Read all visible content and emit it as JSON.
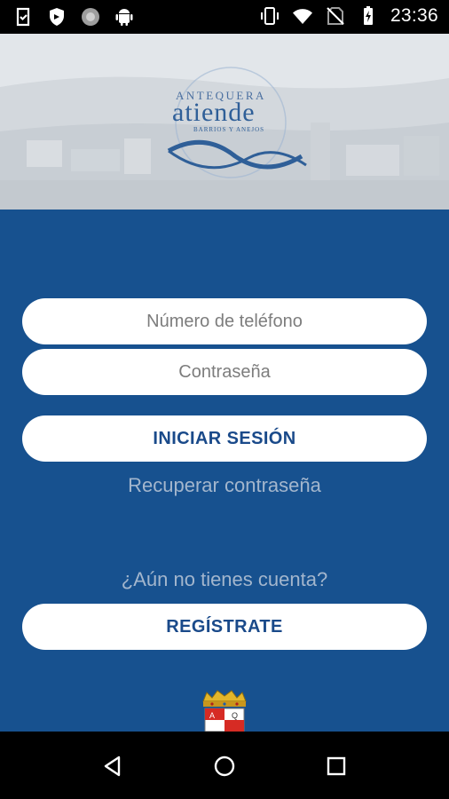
{
  "status_bar": {
    "time": "23:36",
    "left_icons": [
      "clipboard-check-icon",
      "shield-icon",
      "circle-icon",
      "android-icon"
    ],
    "right_icons": [
      "vibrate-icon",
      "wifi-icon",
      "no-sim-icon",
      "battery-charging-icon"
    ]
  },
  "header": {
    "logo_top": "ANTEQUERA",
    "logo_main": "atiende",
    "logo_sub": "BARRIOS Y ANEJOS"
  },
  "login": {
    "phone_placeholder": "Número de teléfono",
    "password_placeholder": "Contraseña",
    "login_button": "INICIAR SESIÓN",
    "recover_link": "Recuperar contraseña",
    "no_account_text": "¿Aún no tienes cuenta?",
    "register_button": "REGÍSTRATE"
  },
  "colors": {
    "background": "#17518f",
    "button_text": "#1a4a8a",
    "muted_text": "#a3b6cd"
  },
  "nav_bar": {
    "icons": [
      "back-icon",
      "home-icon",
      "recent-apps-icon"
    ]
  }
}
